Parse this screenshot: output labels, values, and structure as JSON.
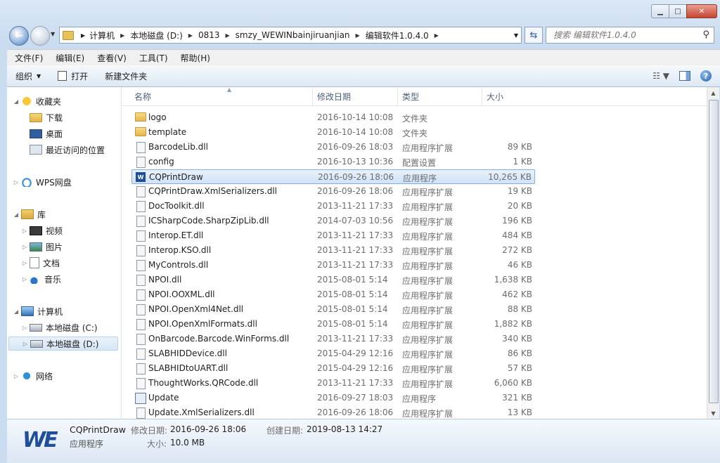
{
  "window_controls": {
    "min": "▁",
    "max": "□",
    "close": "✕"
  },
  "nav": {
    "back": "←",
    "breadcrumbs": [
      "计算机",
      "本地磁盘 (D:)",
      "0813",
      "smzy_WEWINbainjiruanjian",
      "编辑软件1.0.4.0"
    ],
    "search_placeholder": "搜索 编辑软件1.0.4.0"
  },
  "menu": [
    "文件(F)",
    "编辑(E)",
    "查看(V)",
    "工具(T)",
    "帮助(H)"
  ],
  "toolbar": {
    "organize": "组织",
    "open": "打开",
    "new_folder": "新建文件夹"
  },
  "sidebar": {
    "items": [
      {
        "label": "收藏夹",
        "icon": "star-icon"
      },
      {
        "label": "下载",
        "icon": "download-folder-icon"
      },
      {
        "label": "桌面",
        "icon": "desktop-icon"
      },
      {
        "label": "最近访问的位置",
        "icon": "recent-places-icon"
      },
      {
        "label": "WPS网盘",
        "icon": "cloud-icon"
      },
      {
        "label": "库",
        "icon": "library-icon"
      },
      {
        "label": "视频",
        "icon": "video-icon"
      },
      {
        "label": "图片",
        "icon": "picture-icon"
      },
      {
        "label": "文档",
        "icon": "document-icon"
      },
      {
        "label": "音乐",
        "icon": "music-icon"
      },
      {
        "label": "计算机",
        "icon": "computer-icon"
      },
      {
        "label": "本地磁盘 (C:)",
        "icon": "drive-c-icon"
      },
      {
        "label": "本地磁盘 (D:)",
        "icon": "drive-d-icon"
      },
      {
        "label": "网络",
        "icon": "network-icon"
      }
    ]
  },
  "columns": {
    "name": "名称",
    "date": "修改日期",
    "type": "类型",
    "size": "大小"
  },
  "files": [
    {
      "name": "logo",
      "date": "2016-10-14 10:08",
      "type": "文件夹",
      "size": "",
      "kind": "folder"
    },
    {
      "name": "template",
      "date": "2016-10-14 10:08",
      "type": "文件夹",
      "size": "",
      "kind": "folder"
    },
    {
      "name": "BarcodeLib.dll",
      "date": "2016-09-26 18:03",
      "type": "应用程序扩展",
      "size": "89 KB",
      "kind": "dll"
    },
    {
      "name": "config",
      "date": "2016-10-13 10:36",
      "type": "配置设置",
      "size": "1 KB",
      "kind": "config"
    },
    {
      "name": "CQPrintDraw",
      "date": "2016-09-26 18:06",
      "type": "应用程序",
      "size": "10,265 KB",
      "kind": "app"
    },
    {
      "name": "CQPrintDraw.XmlSerializers.dll",
      "date": "2016-09-26 18:06",
      "type": "应用程序扩展",
      "size": "19 KB",
      "kind": "dll"
    },
    {
      "name": "DocToolkit.dll",
      "date": "2013-11-21 17:33",
      "type": "应用程序扩展",
      "size": "20 KB",
      "kind": "dll"
    },
    {
      "name": "ICSharpCode.SharpZipLib.dll",
      "date": "2014-07-03 10:56",
      "type": "应用程序扩展",
      "size": "196 KB",
      "kind": "dll"
    },
    {
      "name": "Interop.ET.dll",
      "date": "2013-11-21 17:33",
      "type": "应用程序扩展",
      "size": "484 KB",
      "kind": "dll"
    },
    {
      "name": "Interop.KSO.dll",
      "date": "2013-11-21 17:33",
      "type": "应用程序扩展",
      "size": "272 KB",
      "kind": "dll"
    },
    {
      "name": "MyControls.dll",
      "date": "2013-11-21 17:33",
      "type": "应用程序扩展",
      "size": "46 KB",
      "kind": "dll"
    },
    {
      "name": "NPOI.dll",
      "date": "2015-08-01 5:14",
      "type": "应用程序扩展",
      "size": "1,638 KB",
      "kind": "dll"
    },
    {
      "name": "NPOI.OOXML.dll",
      "date": "2015-08-01 5:14",
      "type": "应用程序扩展",
      "size": "462 KB",
      "kind": "dll"
    },
    {
      "name": "NPOI.OpenXml4Net.dll",
      "date": "2015-08-01 5:14",
      "type": "应用程序扩展",
      "size": "88 KB",
      "kind": "dll"
    },
    {
      "name": "NPOI.OpenXmlFormats.dll",
      "date": "2015-08-01 5:14",
      "type": "应用程序扩展",
      "size": "1,882 KB",
      "kind": "dll"
    },
    {
      "name": "OnBarcode.Barcode.WinForms.dll",
      "date": "2013-11-21 17:33",
      "type": "应用程序扩展",
      "size": "340 KB",
      "kind": "dll"
    },
    {
      "name": "SLABHIDDevice.dll",
      "date": "2015-04-29 12:16",
      "type": "应用程序扩展",
      "size": "86 KB",
      "kind": "dll"
    },
    {
      "name": "SLABHIDtoUART.dll",
      "date": "2015-04-29 12:16",
      "type": "应用程序扩展",
      "size": "57 KB",
      "kind": "dll"
    },
    {
      "name": "ThoughtWorks.QRCode.dll",
      "date": "2013-11-21 17:33",
      "type": "应用程序扩展",
      "size": "6,060 KB",
      "kind": "dll"
    },
    {
      "name": "Update",
      "date": "2016-09-27 18:03",
      "type": "应用程序",
      "size": "321 KB",
      "kind": "update"
    },
    {
      "name": "Update.XmlSerializers.dll",
      "date": "2016-09-26 18:06",
      "type": "应用程序扩展",
      "size": "13 KB",
      "kind": "dll"
    }
  ],
  "selected_index": 4,
  "details": {
    "logo": "WE",
    "name": "CQPrintDraw",
    "type": "应用程序",
    "modified_label": "修改日期:",
    "modified_value": "2016-09-26 18:06",
    "created_label": "创建日期:",
    "created_value": "2019-08-13 14:27",
    "size_label": "大小:",
    "size_value": "10.0 MB"
  }
}
